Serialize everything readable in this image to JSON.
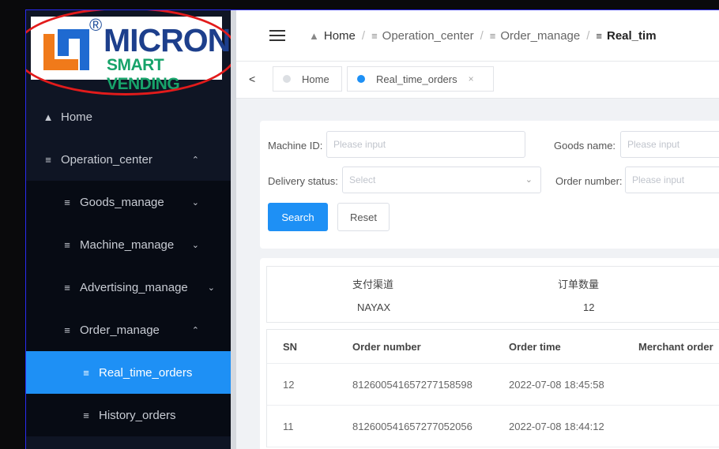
{
  "logo": {
    "brand": "MICRON",
    "tagline": "SMART VENDING",
    "registered": "®"
  },
  "sidebar": {
    "items": [
      {
        "label": "Home",
        "icon": "home-icon",
        "level": 1
      },
      {
        "label": "Operation_center",
        "icon": "menu-icon",
        "level": 1,
        "arrow": "^"
      },
      {
        "label": "Goods_manage",
        "icon": "menu-icon",
        "level": 2,
        "arrow": "v"
      },
      {
        "label": "Machine_manage",
        "icon": "menu-icon",
        "level": 2,
        "arrow": "v"
      },
      {
        "label": "Advertising_manage",
        "icon": "menu-icon",
        "level": 2,
        "arrow": "v"
      },
      {
        "label": "Order_manage",
        "icon": "menu-icon",
        "level": 2,
        "arrow": "^"
      },
      {
        "label": "Real_time_orders",
        "icon": "filter-icon",
        "level": 3,
        "active": true
      },
      {
        "label": "History_orders",
        "icon": "filter-icon",
        "level": 3
      }
    ]
  },
  "breadcrumb": {
    "home": "Home",
    "c1": "Operation_center",
    "c2": "Order_manage",
    "current": "Real_tim"
  },
  "tabs": {
    "home": "Home",
    "active": "Real_time_orders",
    "close": "×",
    "back": "<"
  },
  "filters": {
    "machine_id_label": "Machine ID:",
    "machine_id_placeholder": "Please input",
    "goods_name_label": "Goods name:",
    "goods_name_placeholder": "Please input",
    "delivery_status_label": "Delivery status:",
    "delivery_status_placeholder": "Select",
    "order_number_label": "Order number:",
    "order_number_placeholder": "Please input",
    "search": "Search",
    "reset": "Reset"
  },
  "summary": {
    "headers": [
      "支付渠道",
      "订单数量"
    ],
    "values": [
      "NAYAX",
      "12"
    ]
  },
  "orders": {
    "headers": [
      "SN",
      "Order number",
      "Order time",
      "Merchant order"
    ],
    "rows": [
      {
        "sn": "12",
        "order_number": "812600541657277158598",
        "order_time": "2022-07-08 18:45:58"
      },
      {
        "sn": "11",
        "order_number": "812600541657277052056",
        "order_time": "2022-07-08 18:44:12"
      }
    ]
  },
  "colors": {
    "accent": "#1e90f5",
    "sidebar_bg": "#0f1524",
    "highlight_oval": "#e21b1b"
  }
}
